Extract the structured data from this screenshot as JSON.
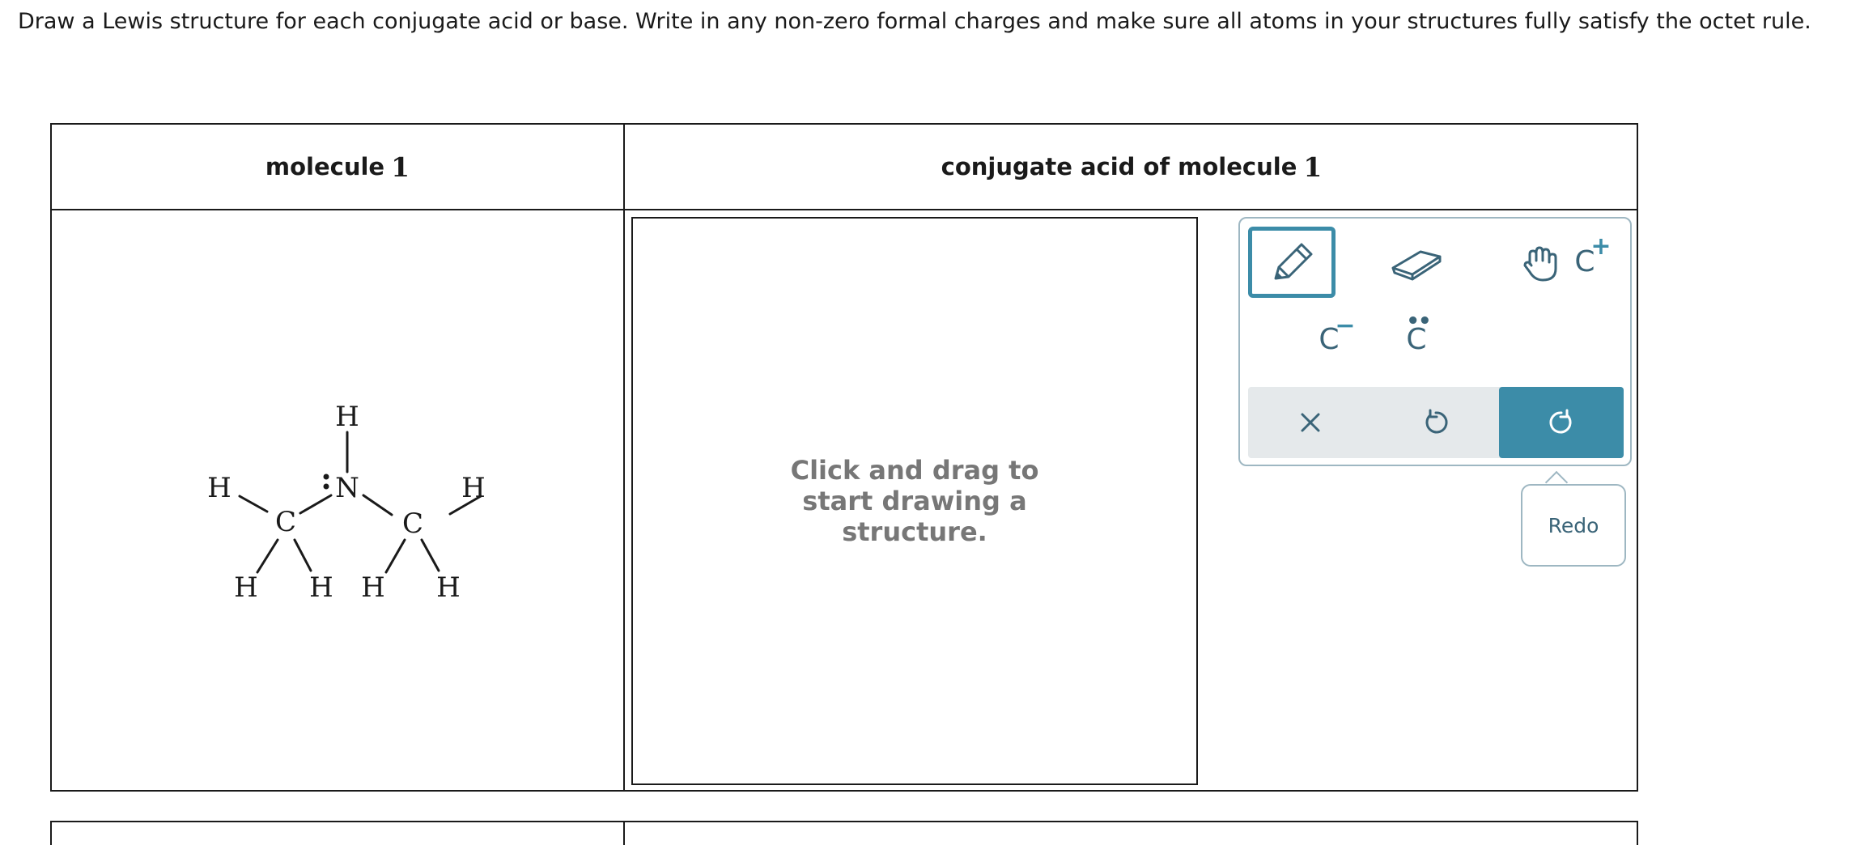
{
  "instructions": "Draw a Lewis structure for each conjugate acid or base. Write in any non-zero formal charges and make sure all atoms in your structures fully satisfy the octet rule.",
  "table": {
    "left_header_label": "molecule",
    "left_header_number": "1",
    "right_header_label": "conjugate acid of molecule",
    "right_header_number": "1"
  },
  "molecule": {
    "atoms": {
      "H": "H",
      "C": "C",
      "N": "N"
    },
    "lone_pair_atom": "N"
  },
  "canvas": {
    "hint": "Click and drag to start drawing a structure."
  },
  "toolbar": {
    "tools": [
      {
        "name": "pencil-icon",
        "active": true
      },
      {
        "name": "eraser-icon",
        "active": false
      },
      {
        "name": "hand-icon",
        "active": false
      },
      {
        "name": "positive-charge-icon",
        "glyph": "C",
        "superscript": "+",
        "active": false
      },
      {
        "name": "negative-charge-icon",
        "glyph": "C",
        "superscript": "−",
        "active": false
      },
      {
        "name": "lone-pair-icon",
        "glyph": "C",
        "superscript": "••",
        "active": false
      }
    ],
    "actions": [
      "clear-icon",
      "undo-icon",
      "redo-icon"
    ],
    "accent_color": "#3c8ca8",
    "icon_color": "#3a6478"
  },
  "tooltip": {
    "text": "Redo"
  }
}
